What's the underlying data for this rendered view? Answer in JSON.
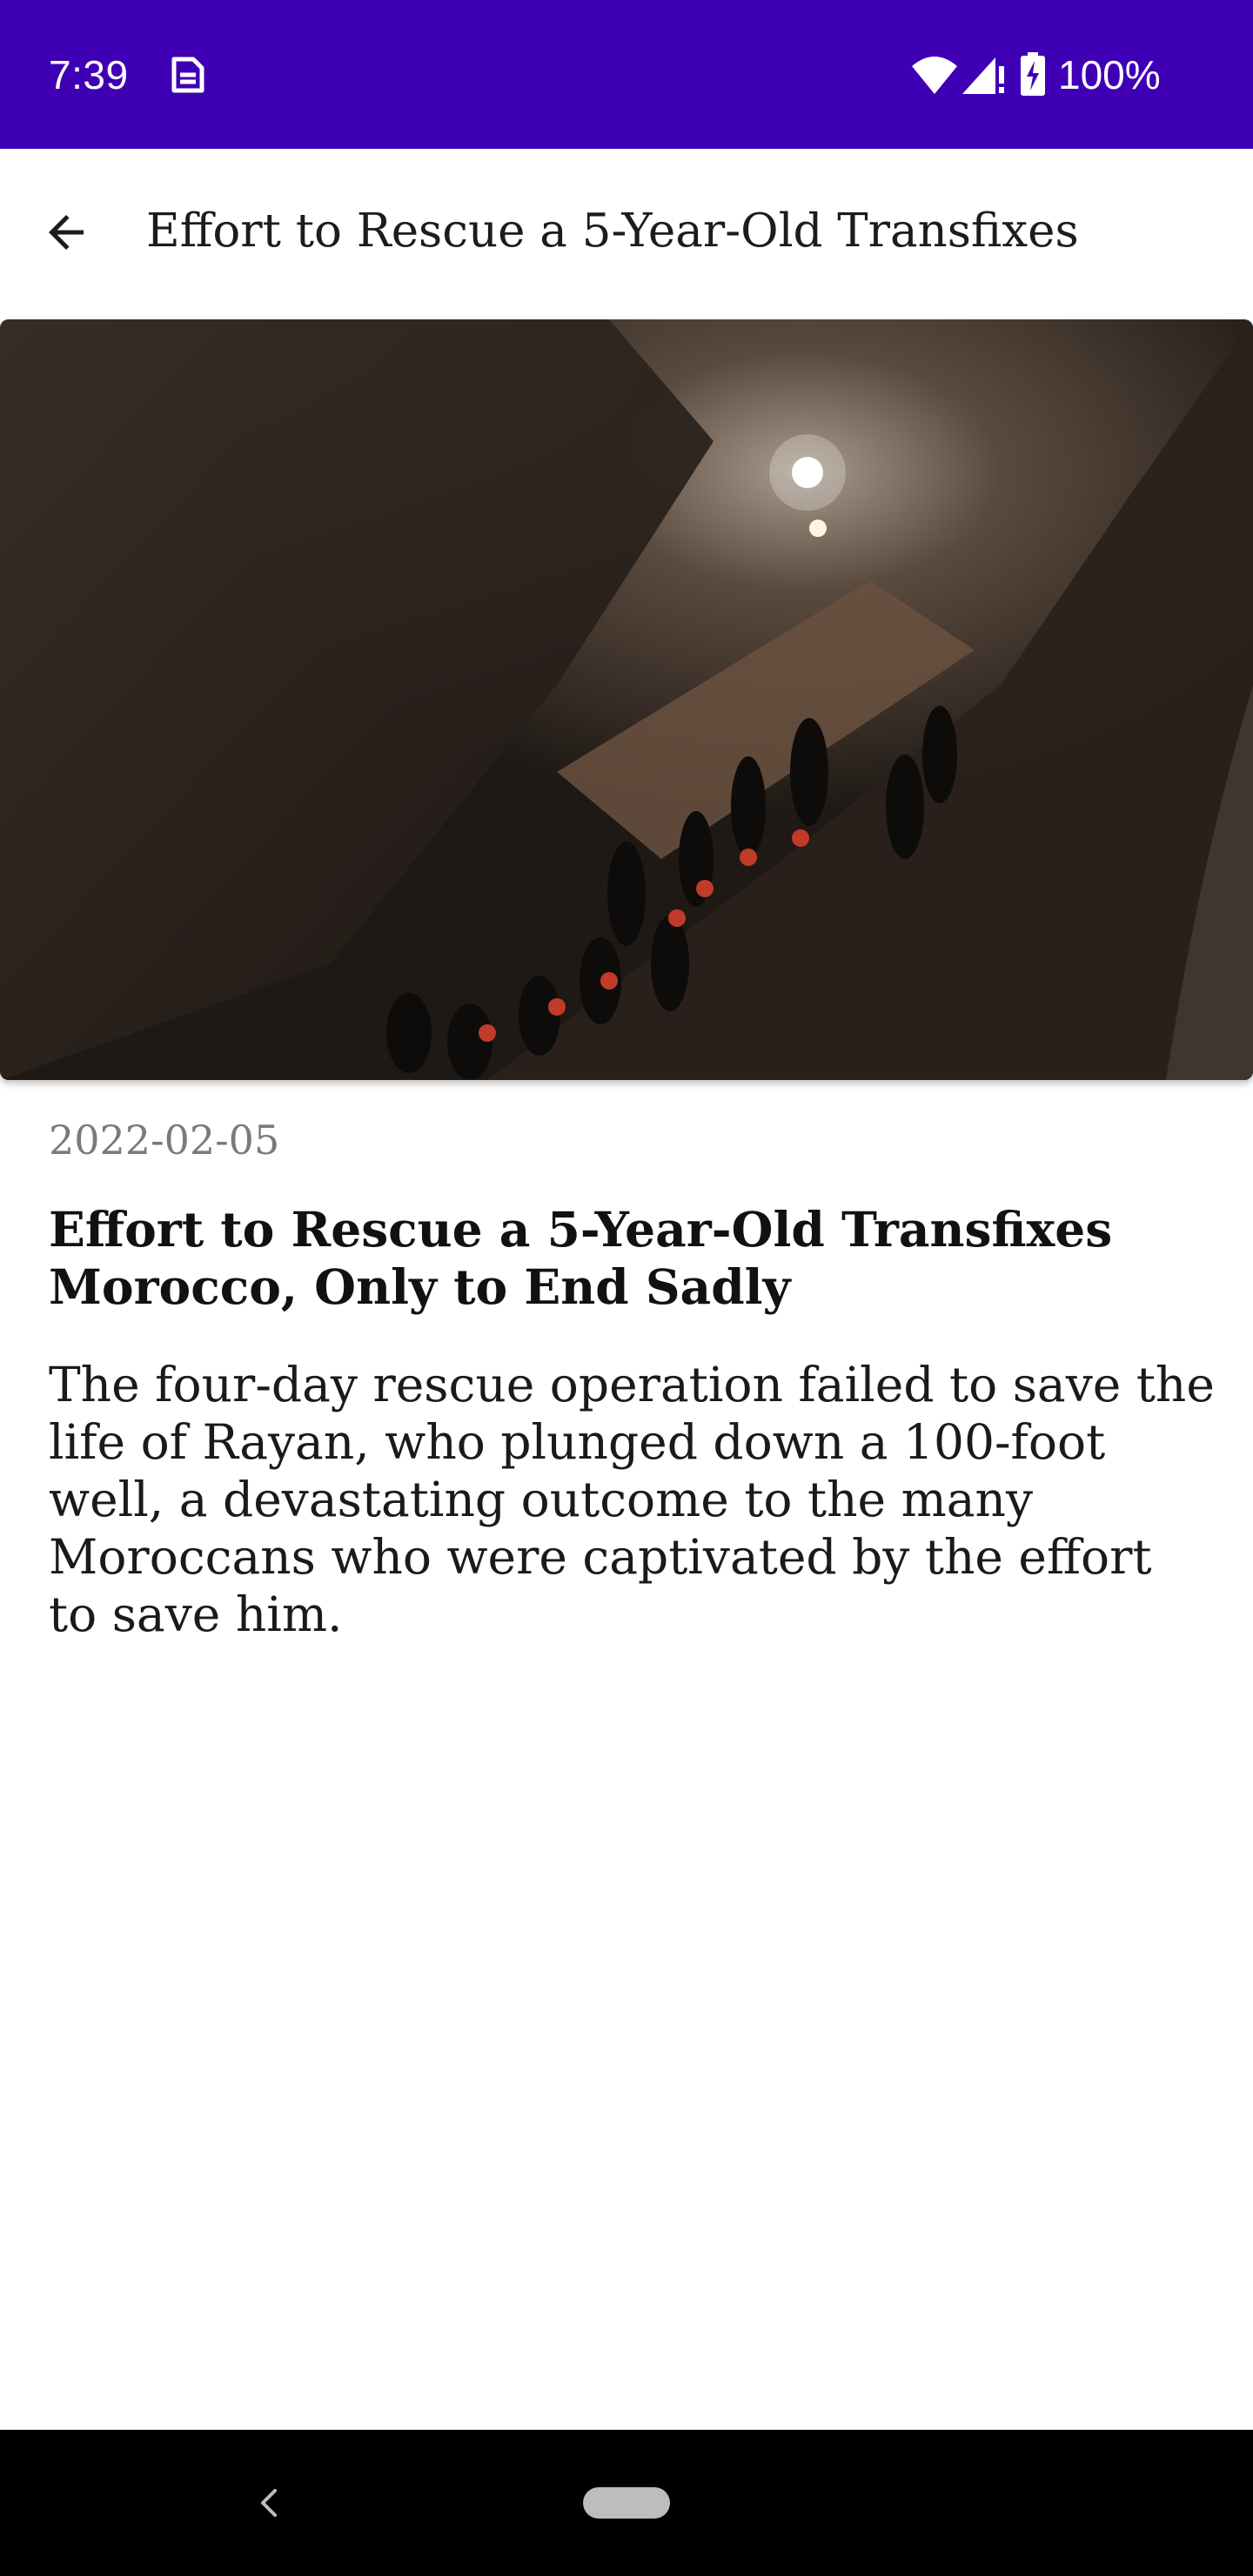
{
  "status_bar": {
    "time": "7:39",
    "battery_text": "100%",
    "background_color": "#3f00b5",
    "icons": [
      "sim-card-icon",
      "wifi-icon",
      "cell-signal-icon",
      "battery-charging-icon"
    ]
  },
  "app_bar": {
    "title": "Effort to Rescue a 5-Year-Old Transfixes",
    "back_icon": "arrow-back-icon"
  },
  "article": {
    "date": "2022-02-05",
    "title": "Effort to Rescue a 5-Year-Old Transfixes Morocco, Only to End Sadly",
    "body": "The four-day rescue operation failed to save the life of Rayan, who plunged down a 100-foot well, a devastating outcome to the many Moroccans who were captivated by the effort to save him."
  },
  "nav_bar": {
    "icons": [
      "nav-back-icon",
      "home-pill-icon"
    ]
  }
}
